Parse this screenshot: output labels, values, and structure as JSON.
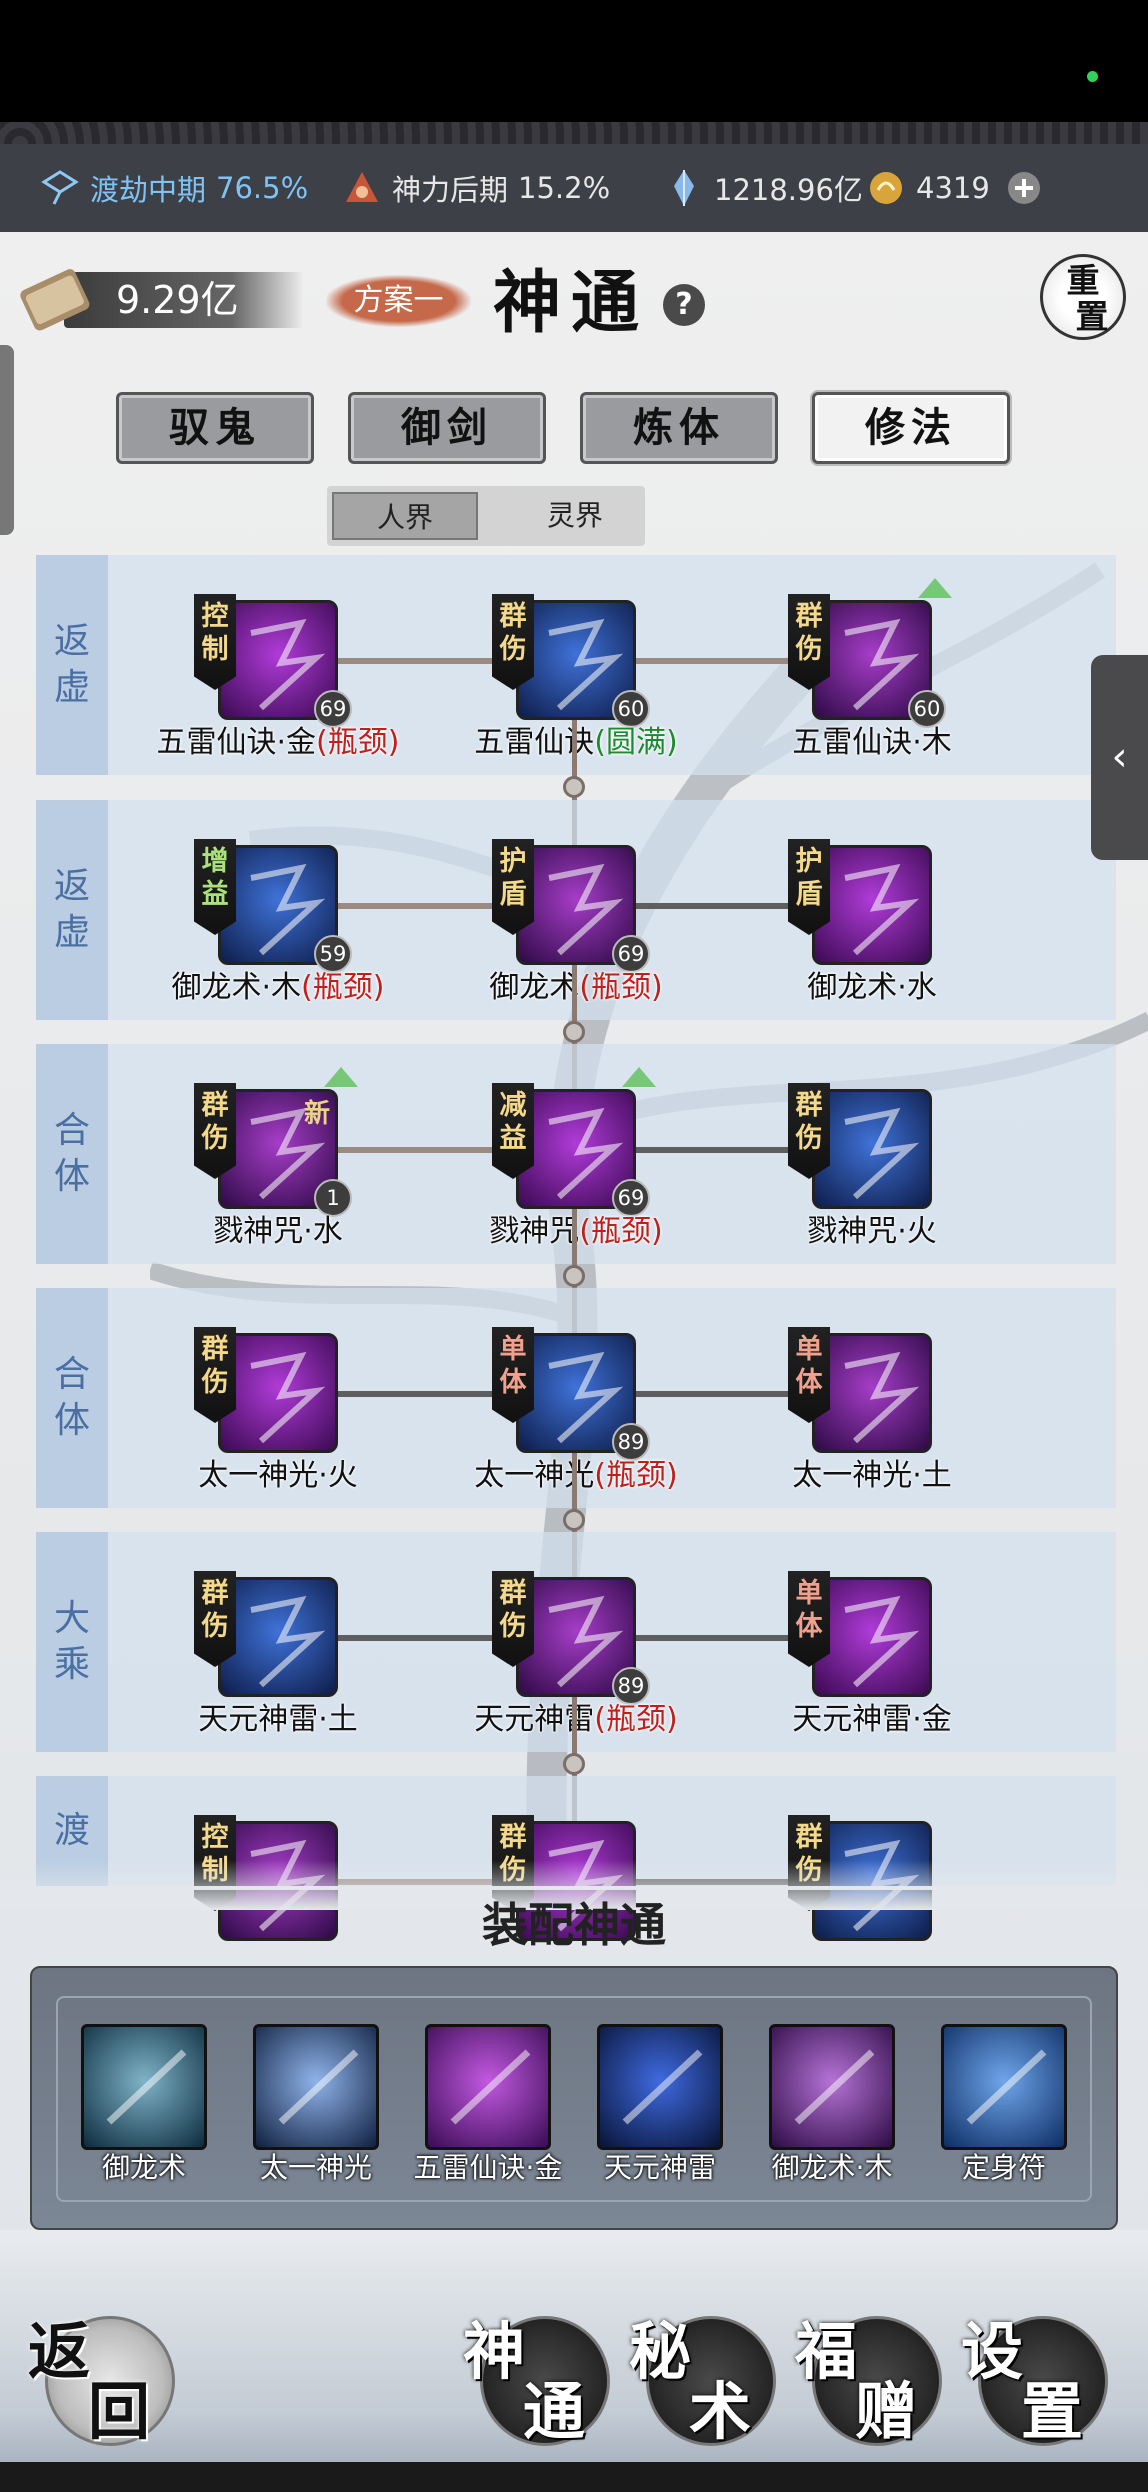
{
  "statusbar": {
    "stat1_label": "渡劫中期",
    "stat1_pct": "76.5%",
    "stat2_label": "神力后期",
    "stat2_pct": "15.2%",
    "currency1": "1218.96亿",
    "currency2": "4319"
  },
  "header": {
    "money": "9.29亿",
    "plan": "方案一",
    "title": "神通",
    "help": "?",
    "reset_top": "重",
    "reset_bottom": "置"
  },
  "tabs": [
    {
      "label": "驭鬼",
      "active": false
    },
    {
      "label": "御剑",
      "active": false
    },
    {
      "label": "炼体",
      "active": false
    },
    {
      "label": "修法",
      "active": true
    }
  ],
  "subtabs": [
    {
      "label": "人界",
      "active": true
    },
    {
      "label": "灵界",
      "active": false
    }
  ],
  "rows": [
    {
      "realm": [
        "返",
        "虚"
      ],
      "skills": [
        {
          "tag": [
            "控",
            "制"
          ],
          "level": "69",
          "name": "五雷仙诀·金",
          "suffix": "瓶颈",
          "suffix_color": "red"
        },
        {
          "tag": [
            "群",
            "伤"
          ],
          "level": "60",
          "name": "五雷仙诀",
          "suffix": "圆满",
          "suffix_color": "green"
        },
        {
          "tag": [
            "群",
            "伤"
          ],
          "level": "60",
          "name": "五雷仙诀·木",
          "suffix": "",
          "up": true
        }
      ]
    },
    {
      "realm": [
        "返",
        "虚"
      ],
      "skills": [
        {
          "tag": [
            "增",
            "益"
          ],
          "level": "59",
          "name": "御龙术·木",
          "suffix": "瓶颈",
          "suffix_color": "red"
        },
        {
          "tag": [
            "护",
            "盾"
          ],
          "level": "69",
          "name": "御龙术",
          "suffix": "瓶颈",
          "suffix_color": "red"
        },
        {
          "tag": [
            "护",
            "盾"
          ],
          "level": "",
          "name": "御龙术·水",
          "suffix": ""
        }
      ]
    },
    {
      "realm": [
        "合",
        "体"
      ],
      "skills": [
        {
          "tag": [
            "群",
            "伤"
          ],
          "level": "1",
          "name": "戮神咒·水",
          "suffix": "",
          "up": true,
          "new": "新"
        },
        {
          "tag": [
            "减",
            "益"
          ],
          "level": "69",
          "name": "戮神咒",
          "suffix": "瓶颈",
          "suffix_color": "red",
          "up": true
        },
        {
          "tag": [
            "群",
            "伤"
          ],
          "level": "",
          "name": "戮神咒·火",
          "suffix": ""
        }
      ]
    },
    {
      "realm": [
        "合",
        "体"
      ],
      "skills": [
        {
          "tag": [
            "群",
            "伤"
          ],
          "level": "",
          "name": "太一神光·火",
          "suffix": ""
        },
        {
          "tag": [
            "单",
            "体"
          ],
          "level": "89",
          "name": "太一神光",
          "suffix": "瓶颈",
          "suffix_color": "red"
        },
        {
          "tag": [
            "单",
            "体"
          ],
          "level": "",
          "name": "太一神光·土",
          "suffix": ""
        }
      ]
    },
    {
      "realm": [
        "大",
        "乘"
      ],
      "skills": [
        {
          "tag": [
            "群",
            "伤"
          ],
          "level": "",
          "name": "天元神雷·土",
          "suffix": ""
        },
        {
          "tag": [
            "群",
            "伤"
          ],
          "level": "89",
          "name": "天元神雷",
          "suffix": "瓶颈",
          "suffix_color": "red"
        },
        {
          "tag": [
            "单",
            "体"
          ],
          "level": "",
          "name": "天元神雷·金",
          "suffix": ""
        }
      ]
    },
    {
      "realm": [
        "渡"
      ],
      "skills": [
        {
          "tag": [
            "控",
            "制"
          ],
          "level": "",
          "name": "",
          "suffix": ""
        },
        {
          "tag": [
            "群",
            "伤"
          ],
          "level": "",
          "name": "",
          "suffix": ""
        },
        {
          "tag": [
            "群",
            "伤"
          ],
          "level": "",
          "name": "",
          "suffix": ""
        }
      ]
    }
  ],
  "equip": {
    "title": "装配神通",
    "items": [
      "御龙术",
      "太一神光",
      "五雷仙诀·金",
      "天元神雷",
      "御龙术·木",
      "定身符"
    ]
  },
  "bottom_nav": [
    {
      "t1": "返",
      "t2": "回"
    },
    {
      "t1": "神",
      "t2": "通"
    },
    {
      "t1": "秘",
      "t2": "术"
    },
    {
      "t1": "福",
      "t2": "赠"
    },
    {
      "t1": "设",
      "t2": "置"
    }
  ],
  "colors": {
    "bottleneck": "#c0201c",
    "complete": "#1d8a2f",
    "realm_text": "#4a6fa3"
  },
  "icons": [
    "kite-icon",
    "triangle-emblem-icon",
    "crystal-icon",
    "coin-icon",
    "plus-icon",
    "scroll-icon",
    "chevron-left-icon"
  ]
}
